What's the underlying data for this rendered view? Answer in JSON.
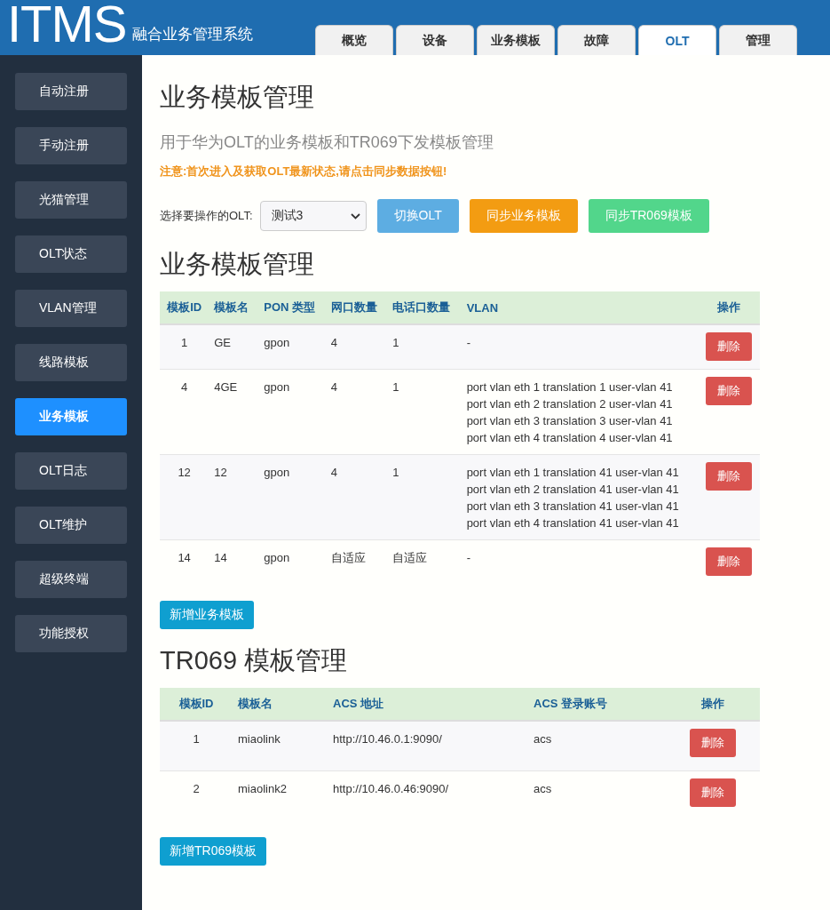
{
  "header": {
    "logo": "ITMS",
    "subtitle": "融合业务管理系统"
  },
  "tabs": [
    {
      "label": "概览",
      "selected": false
    },
    {
      "label": "设备",
      "selected": false
    },
    {
      "label": "业务模板",
      "selected": false
    },
    {
      "label": "故障",
      "selected": false
    },
    {
      "label": "OLT",
      "selected": true
    },
    {
      "label": "管理",
      "selected": false
    }
  ],
  "sidebar": {
    "items": [
      {
        "label": "自动注册",
        "selected": false
      },
      {
        "label": "手动注册",
        "selected": false
      },
      {
        "label": "光猫管理",
        "selected": false
      },
      {
        "label": "OLT状态",
        "selected": false
      },
      {
        "label": "VLAN管理",
        "selected": false
      },
      {
        "label": "线路模板",
        "selected": false
      },
      {
        "label": "业务模板",
        "selected": true
      },
      {
        "label": "OLT日志",
        "selected": false
      },
      {
        "label": "OLT维护",
        "selected": false
      },
      {
        "label": "超级终端",
        "selected": false
      },
      {
        "label": "功能授权",
        "selected": false
      }
    ]
  },
  "page_title": "业务模板管理",
  "subtitle": "用于华为OLT的业务模板和TR069下发模板管理",
  "notice": "注意:首次进入及获取OLT最新状态,请点击同步数据按钮!",
  "olt_select": {
    "label": "选择要操作的OLT:",
    "value": "测试3"
  },
  "toolbar_buttons": [
    {
      "label": "切换OLT",
      "kind": "info"
    },
    {
      "label": "同步业务模板",
      "kind": "warning"
    },
    {
      "label": "同步TR069模板",
      "kind": "success"
    }
  ],
  "service_section": {
    "title": "业务模板管理",
    "table": {
      "columns": [
        "模板ID",
        "模板名",
        "PON 类型",
        "网口数量",
        "电话口数量",
        "VLAN",
        "操作"
      ],
      "rows": [
        {
          "id": "1",
          "name": "GE",
          "pon_type": "gpon",
          "eth_ports": "4",
          "phone_ports": "1",
          "vlan": [
            "-"
          ],
          "action": "删除"
        },
        {
          "id": "4",
          "name": "4GE",
          "pon_type": "gpon",
          "eth_ports": "4",
          "phone_ports": "1",
          "vlan": [
            "port vlan eth 1 translation 1 user-vlan 41",
            "port vlan eth 2 translation 2 user-vlan 41",
            "port vlan eth 3 translation 3 user-vlan 41",
            "port vlan eth 4 translation 4 user-vlan 41"
          ],
          "action": "删除"
        },
        {
          "id": "12",
          "name": "12",
          "pon_type": "gpon",
          "eth_ports": "4",
          "phone_ports": "1",
          "vlan": [
            "port vlan eth 1 translation 41 user-vlan 41",
            "port vlan eth 2 translation 41 user-vlan 41",
            "port vlan eth 3 translation 41 user-vlan 41",
            "port vlan eth 4 translation 41 user-vlan 41"
          ],
          "action": "删除"
        },
        {
          "id": "14",
          "name": "14",
          "pon_type": "gpon",
          "eth_ports": "自适应",
          "phone_ports": "自适应",
          "vlan": [
            "-"
          ],
          "action": "删除"
        }
      ]
    },
    "add_button": "新增业务模板"
  },
  "tr069_section": {
    "title": "TR069 模板管理",
    "table": {
      "columns": [
        "模板ID",
        "模板名",
        "ACS 地址",
        "ACS 登录账号",
        "操作"
      ],
      "rows": [
        {
          "id": "1",
          "name": "miaolink",
          "acs_url": "http://10.46.0.1:9090/",
          "acs_user": "acs",
          "action": "删除"
        },
        {
          "id": "2",
          "name": "miaolink2",
          "acs_url": "http://10.46.0.46:9090/",
          "acs_user": "acs",
          "action": "删除"
        }
      ]
    },
    "add_button": "新增TR069模板"
  }
}
